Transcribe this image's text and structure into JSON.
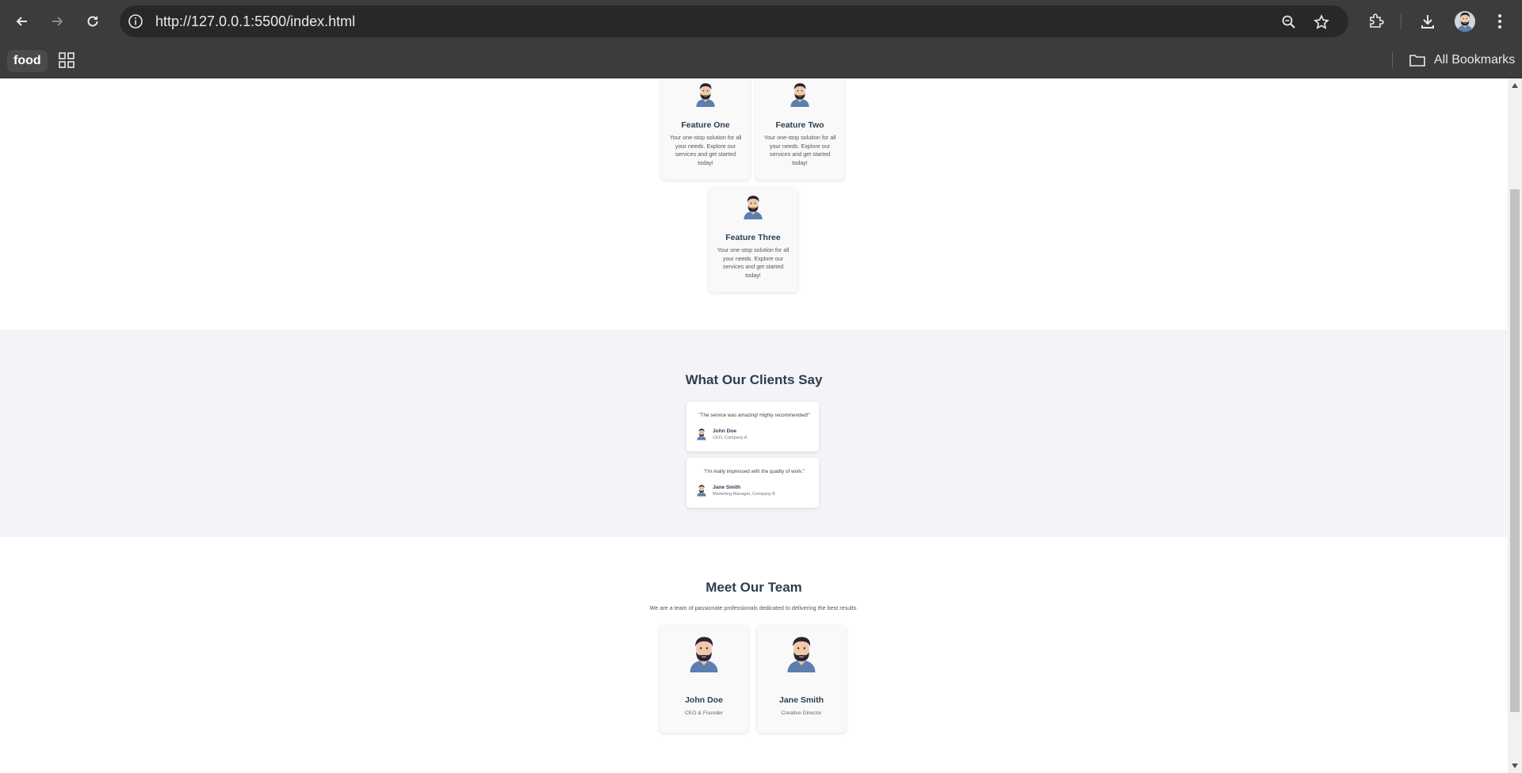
{
  "browser": {
    "url": "http://127.0.0.1:5500/index.html",
    "bookmark_food": "food",
    "all_bookmarks": "All Bookmarks"
  },
  "features": [
    {
      "title": "Feature One",
      "desc": "Your one-stop solution for all your needs. Explore our services and get started today!"
    },
    {
      "title": "Feature Two",
      "desc": "Your one-stop solution for all your needs. Explore our services and get started today!"
    },
    {
      "title": "Feature Three",
      "desc": "Your one-stop solution for all your needs. Explore our services and get started today!"
    }
  ],
  "testimonials": {
    "title": "What Our Clients Say",
    "items": [
      {
        "quote": "\"The service was amazing! Highly recommended!\"",
        "name": "John Doe",
        "role": "CEO, Company A"
      },
      {
        "quote": "\"I'm really impressed with the quality of work.\"",
        "name": "Jane Smith",
        "role": "Marketing Manager, Company B"
      }
    ]
  },
  "team": {
    "title": "Meet Our Team",
    "subtitle": "We are a team of passionate professionals dedicated to delivering the best results.",
    "members": [
      {
        "name": "John Doe",
        "role": "CEO & Founder"
      },
      {
        "name": "Jane Smith",
        "role": "Creative Director"
      }
    ]
  },
  "colors": {
    "chrome": "#3c3c3c",
    "omnibox": "#282828",
    "heading": "#2c3e50",
    "testimonial_bg": "#f4f4f8"
  },
  "icons": [
    "back-arrow-icon",
    "forward-arrow-icon",
    "reload-icon",
    "site-info-icon",
    "zoom-icon",
    "star-icon",
    "extensions-icon",
    "download-icon",
    "kebab-menu-icon",
    "apps-grid-icon",
    "folder-icon",
    "avatar-face-icon"
  ]
}
